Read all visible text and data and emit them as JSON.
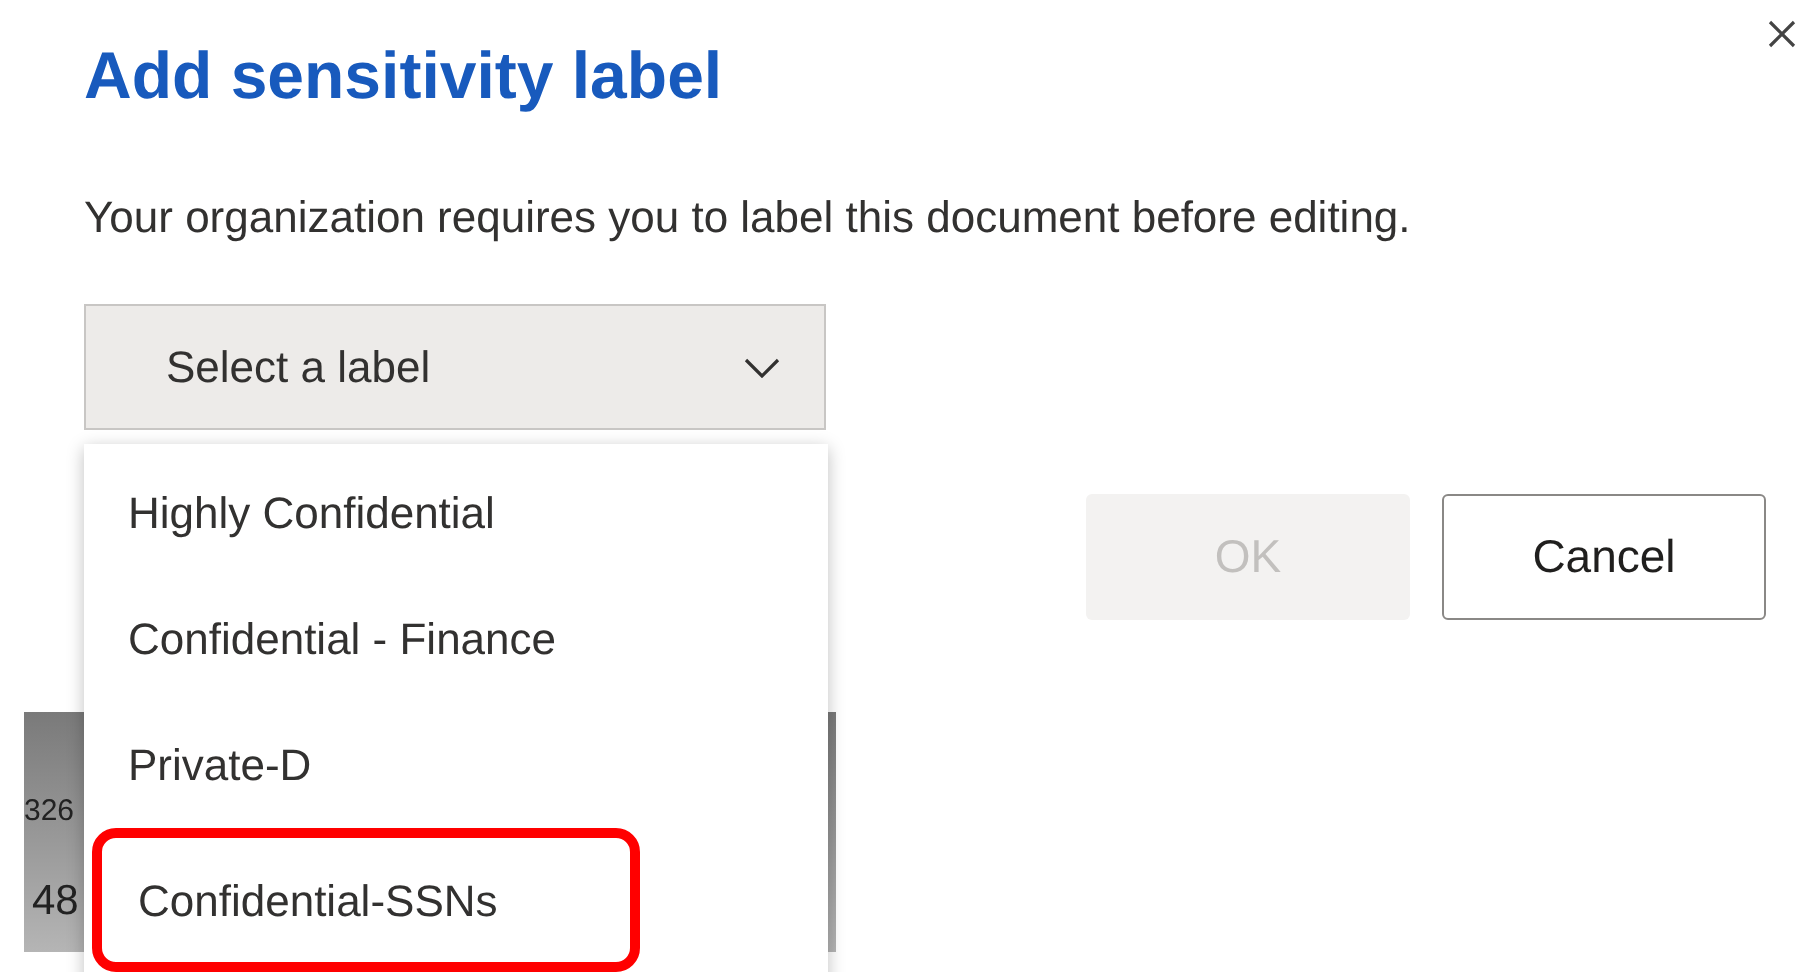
{
  "dialog": {
    "title": "Add sensitivity label",
    "description": "Your organization requires you to label this document before editing."
  },
  "label_select": {
    "placeholder": "Select a label",
    "expanded": true
  },
  "options": [
    {
      "label": "Highly Confidential",
      "highlighted": false
    },
    {
      "label": "Confidential - Finance",
      "highlighted": false
    },
    {
      "label": "Private-D",
      "highlighted": false
    },
    {
      "label": "Confidential-SSNs",
      "highlighted": true
    }
  ],
  "buttons": [
    {
      "label": "OK",
      "disabled": true
    },
    {
      "label": "Cancel",
      "disabled": false
    }
  ],
  "background_document": {
    "column_1": [
      "326",
      "48"
    ]
  }
}
